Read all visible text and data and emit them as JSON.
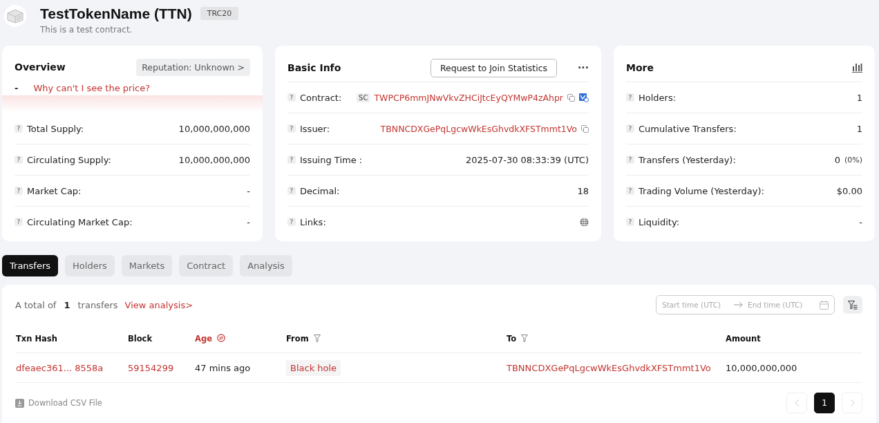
{
  "header": {
    "title": "TestTokenName (TTN)",
    "badge": "TRC20",
    "description": "This is a test contract."
  },
  "overview": {
    "title": "Overview",
    "reputation_button": "Reputation: Unknown >",
    "price": "-",
    "price_link": "Why can't I see the price?",
    "rows": [
      {
        "help": "?",
        "label": "Total Supply:",
        "value": "10,000,000,000"
      },
      {
        "help": "?",
        "label": "Circulating Supply:",
        "value": "10,000,000,000"
      },
      {
        "help": "?",
        "label": "Market Cap:",
        "value": "-"
      },
      {
        "help": "?",
        "label": "Circulating Market Cap:",
        "value": "-"
      }
    ]
  },
  "basic_info": {
    "title": "Basic Info",
    "request_button": "Request to Join Statistics",
    "more_button": "···",
    "rows": [
      {
        "kind": "contract",
        "help": "?",
        "label": "Contract:",
        "tag": "SC",
        "value": "TWPCP6mmJNwVkvZHCiJtcEyQYMwP4zAhpr"
      },
      {
        "kind": "address",
        "help": "?",
        "label": "Issuer:",
        "value": "TBNNCDXGePqLgcwWkEsGhvdkXFSTmmt1Vo"
      },
      {
        "kind": "text",
        "help": "?",
        "label": "Issuing Time :",
        "value": "2025-07-30 08:33:39 (UTC)"
      },
      {
        "kind": "text",
        "help": "?",
        "label": "Decimal:",
        "value": "18"
      },
      {
        "kind": "links",
        "help": "?",
        "label": "Links:"
      }
    ]
  },
  "more": {
    "title": "More",
    "rows": [
      {
        "help": "?",
        "label": "Holders:",
        "value": "1"
      },
      {
        "help": "?",
        "label": "Cumulative Transfers:",
        "value": "1"
      },
      {
        "help": "?",
        "label": "Transfers (Yesterday):",
        "value": "0",
        "note": "(0%)"
      },
      {
        "help": "?",
        "label": "Trading Volume (Yesterday):",
        "value": "$0.00"
      },
      {
        "help": "?",
        "label": "Liquidity:",
        "value": "-"
      }
    ]
  },
  "tabs": [
    {
      "label": "Transfers",
      "selected": true
    },
    {
      "label": "Holders",
      "selected": false
    },
    {
      "label": "Markets",
      "selected": false
    },
    {
      "label": "Contract",
      "selected": false
    },
    {
      "label": "Analysis",
      "selected": false
    }
  ],
  "transfers": {
    "summary_prefix": "A total of",
    "count": "1",
    "summary_suffix": "transfers",
    "analysis_link": "View analysis>",
    "date_range": {
      "start_placeholder": "Start time (UTC)",
      "end_placeholder": "End time (UTC)"
    },
    "columns": [
      {
        "label": "Txn Hash",
        "kind": "plain"
      },
      {
        "label": "Block",
        "kind": "plain"
      },
      {
        "label": "Age",
        "kind": "sort"
      },
      {
        "label": "From",
        "kind": "filter"
      },
      {
        "label": "To",
        "kind": "filter"
      },
      {
        "label": "Amount",
        "kind": "plain"
      }
    ],
    "rows": [
      {
        "txn_hash": "dfeaec361... 8558a",
        "block": "59154299",
        "age": "47 mins ago",
        "from": "Black hole",
        "to": "TBNNCDXGePqLgcwWkEsGhvdkXFSTmmt1Vo",
        "amount": "10,000,000,000"
      }
    ],
    "download": "Download CSV File",
    "pages": [
      {
        "label": "1",
        "selected": true
      }
    ]
  }
}
